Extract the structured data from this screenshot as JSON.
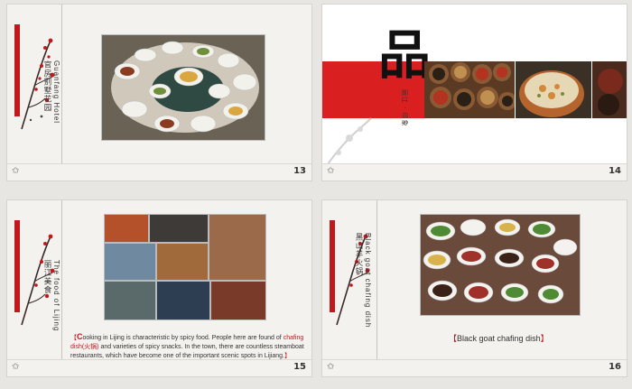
{
  "slides": [
    {
      "number": "13",
      "title_cn": "官房别墅花园",
      "title_en": "Guanfang Hotel"
    },
    {
      "number": "14",
      "big_char": "品",
      "sub_cn": "丽江 · 印象"
    },
    {
      "number": "15",
      "title_cn": "丽江美食",
      "title_en": "The food of Lijing",
      "caption": {
        "open": "【",
        "first_letter": "C",
        "part1": "ooking in Lijing is characteristic by spicy food. People here are found of ",
        "highlight": "chafing dish(火锅)",
        "part2": " and varieties of spicy snacks. In the town, there are countless steamboat restaurants, which have become one of the important scenic spots in Lijiang.",
        "close": "】"
      }
    },
    {
      "number": "16",
      "title_cn": "黑山羊火锅",
      "title_en": "Black goat chafing dish",
      "caption": {
        "open": "【",
        "text": "Black goat chafing dish",
        "close": "】"
      }
    }
  ],
  "footer_star": "✩",
  "colors": {
    "accent": "#c0181c",
    "paper": "#f4f2ef"
  }
}
